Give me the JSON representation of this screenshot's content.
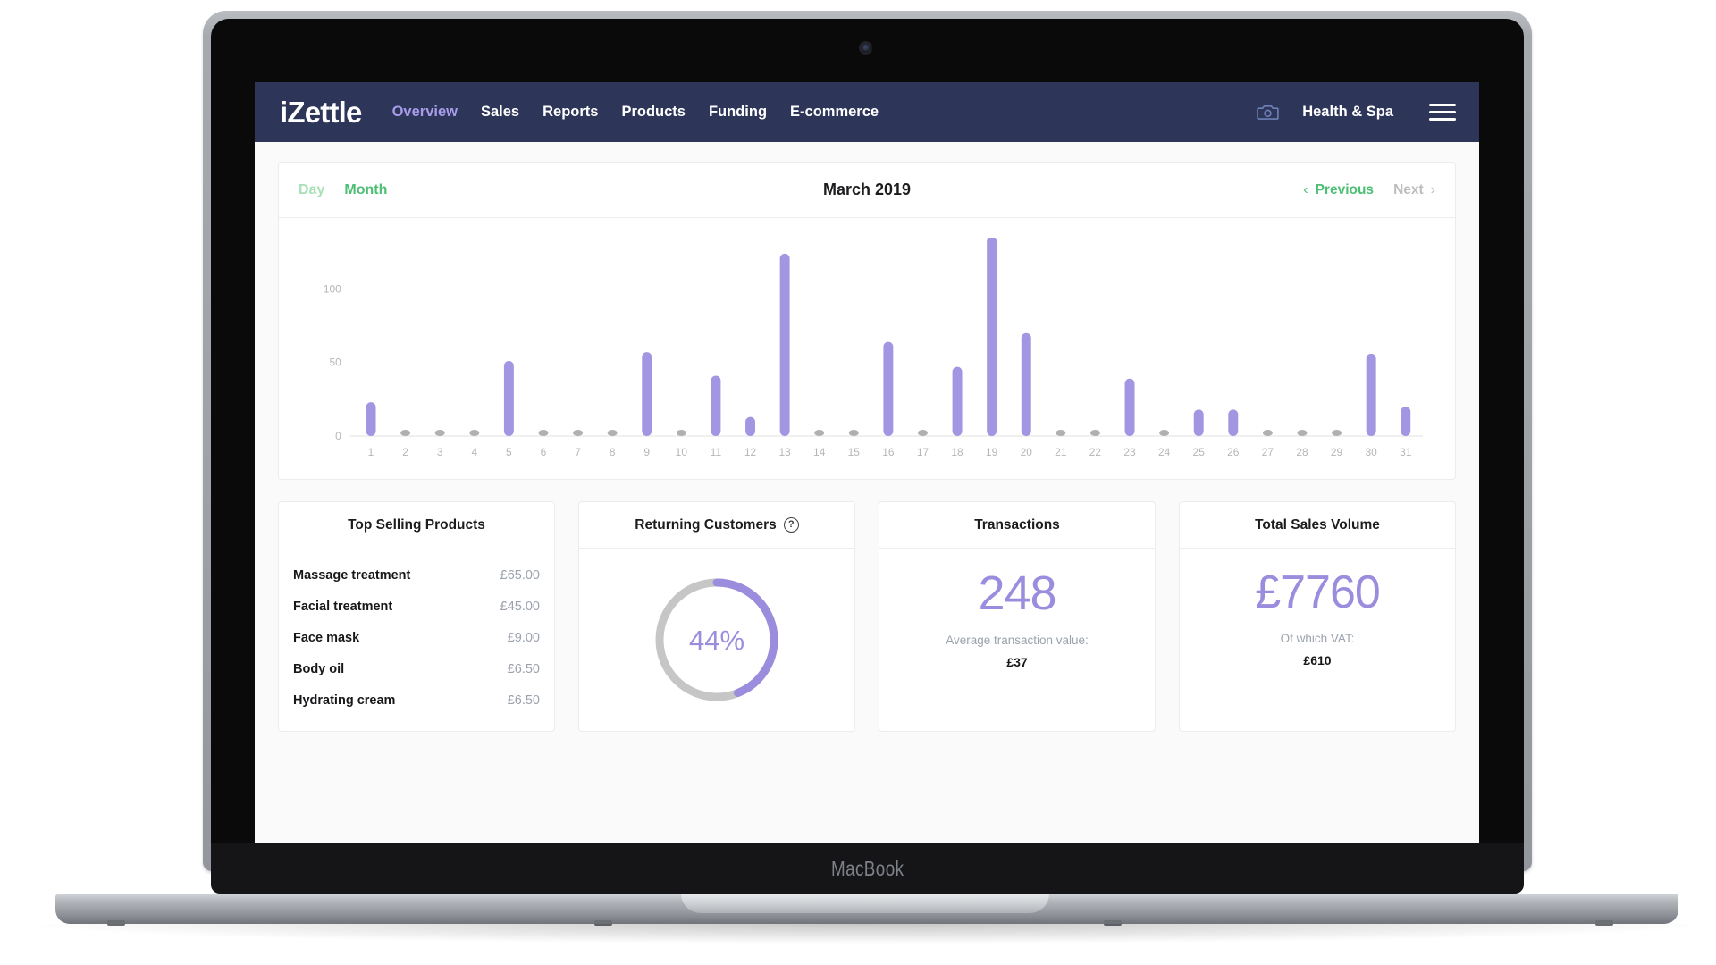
{
  "device": {
    "model_label": "MacBook",
    "camera_icon": "webcam-dot"
  },
  "navbar": {
    "brand": "iZettle",
    "links": [
      {
        "label": "Overview",
        "active": true
      },
      {
        "label": "Sales",
        "active": false
      },
      {
        "label": "Reports",
        "active": false
      },
      {
        "label": "Products",
        "active": false
      },
      {
        "label": "Funding",
        "active": false
      },
      {
        "label": "E-commerce",
        "active": false
      }
    ],
    "camera_icon": "camera-icon",
    "account_name": "Health & Spa",
    "menu_icon": "hamburger-menu-icon",
    "background_color": "#2d3559",
    "active_link_color": "#a79bea"
  },
  "chart_header": {
    "range_tabs": [
      {
        "label": "Day",
        "active": false
      },
      {
        "label": "Month",
        "active": true
      }
    ],
    "period_title": "March 2019",
    "previous_label": "Previous",
    "next_label": "Next",
    "prev_chevron": "‹",
    "next_chevron": "›",
    "active_tab_color": "#4dbf74",
    "inactive_tab_color": "#a9e0b8",
    "next_disabled_color": "#bdbdbd"
  },
  "chart_data": {
    "type": "bar",
    "title": "March 2019",
    "xlabel": "",
    "ylabel": "",
    "ylim": [
      0,
      130
    ],
    "yticks": [
      0,
      50,
      100
    ],
    "ytick_labels": [
      "0",
      "50",
      "100"
    ],
    "grid": false,
    "legend": "none",
    "bar_color": "#a295e2",
    "zero_marker_color": "#b0b0b0",
    "categories": [
      "1",
      "2",
      "3",
      "4",
      "5",
      "6",
      "7",
      "8",
      "9",
      "10",
      "11",
      "12",
      "13",
      "14",
      "15",
      "16",
      "17",
      "18",
      "19",
      "20",
      "21",
      "22",
      "23",
      "24",
      "25",
      "26",
      "27",
      "28",
      "29",
      "30",
      "31"
    ],
    "values": [
      23,
      2,
      2,
      1,
      51,
      2,
      1,
      1,
      57,
      1,
      41,
      13,
      124,
      1,
      1,
      64,
      1,
      47,
      136,
      70,
      1,
      1,
      39,
      2,
      18,
      18,
      3,
      1,
      1,
      56,
      20
    ]
  },
  "cards": {
    "top_products": {
      "title": "Top Selling Products",
      "items": [
        {
          "name": "Massage treatment",
          "price": "£65.00"
        },
        {
          "name": "Facial treatment",
          "price": "£45.00"
        },
        {
          "name": "Face mask",
          "price": "£9.00"
        },
        {
          "name": "Body oil",
          "price": "£6.50"
        },
        {
          "name": "Hydrating cream",
          "price": "£6.50"
        }
      ]
    },
    "returning_customers": {
      "title": "Returning Customers",
      "help_icon": "question-mark-icon",
      "percent_label": "44%",
      "percent_value": 44,
      "arc_color": "#9b8cdd",
      "track_color": "#c6c6c6"
    },
    "transactions": {
      "title": "Transactions",
      "value": "248",
      "sub_label": "Average transaction value:",
      "sub_value": "£37"
    },
    "total_sales_volume": {
      "title": "Total Sales Volume",
      "value": "£7760",
      "sub_label": "Of which VAT:",
      "sub_value": "£610"
    }
  }
}
